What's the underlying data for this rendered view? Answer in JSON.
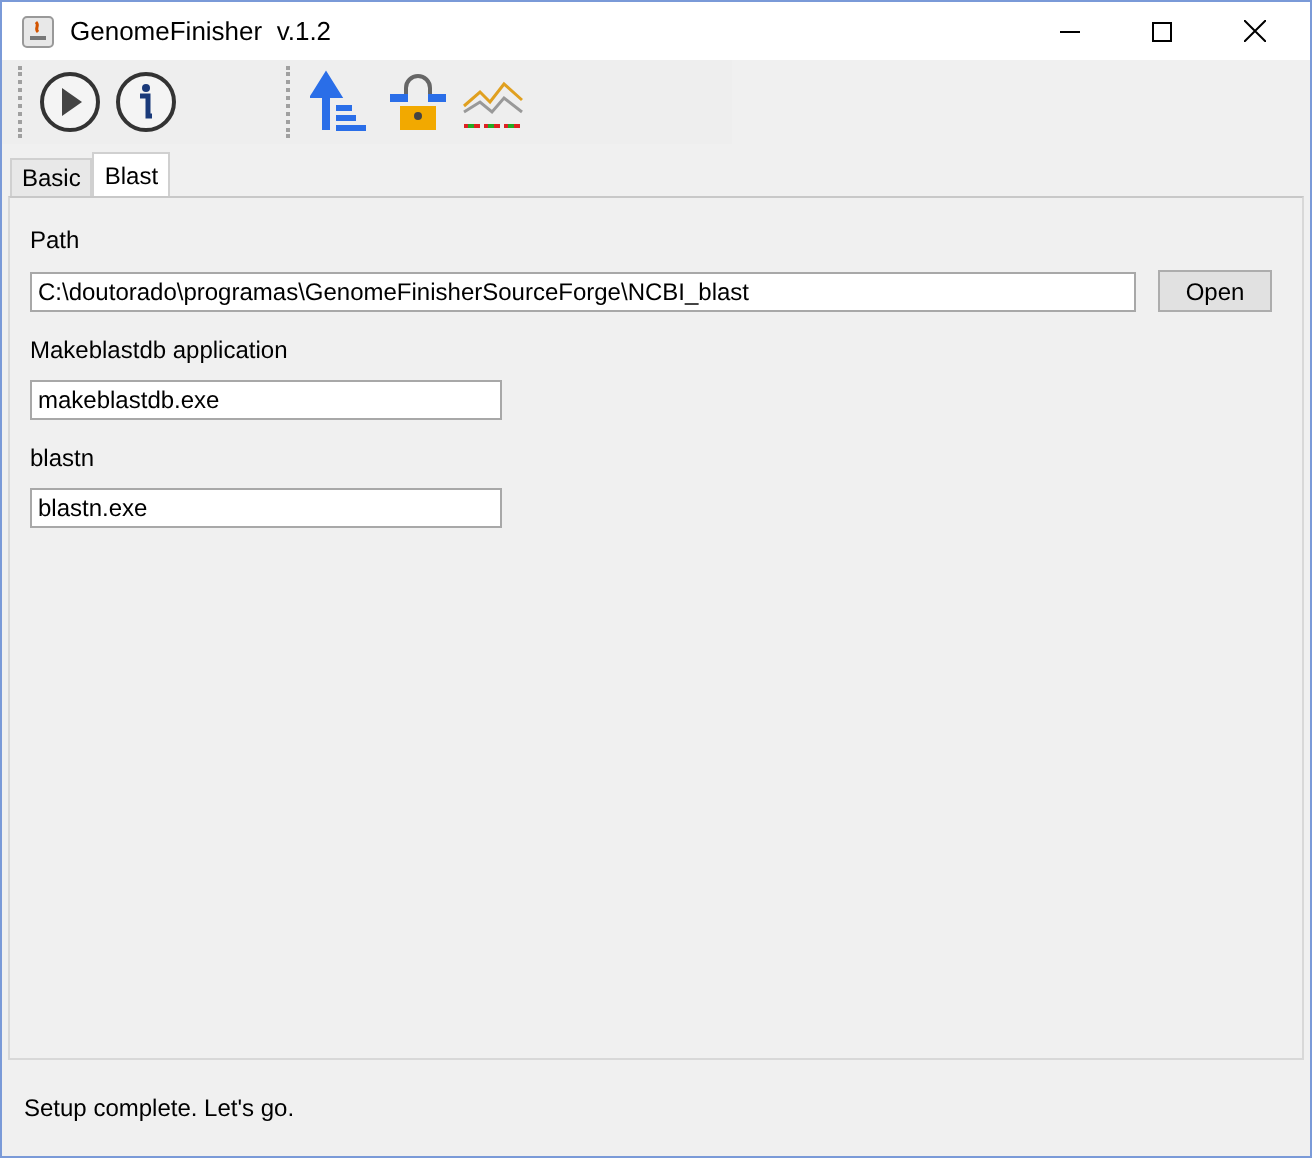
{
  "window": {
    "title": "GenomeFinisher  v.1.2"
  },
  "tabs": [
    {
      "label": "Basic",
      "selected": false
    },
    {
      "label": "Blast",
      "selected": true
    }
  ],
  "fields": [
    {
      "label": "Path",
      "value": "C:\\doutorado\\programas\\GenomeFinisherSourceForge\\NCBI_blast",
      "button": "Open"
    },
    {
      "label": "Makeblastdb application",
      "value": "makeblastdb.exe"
    },
    {
      "label": "blastn",
      "value": "blastn.exe"
    }
  ],
  "status_bar": "Setup complete. Let's go."
}
